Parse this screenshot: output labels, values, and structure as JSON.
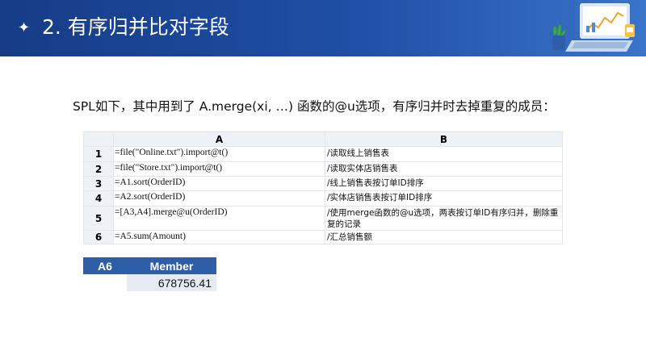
{
  "header": {
    "star": "✦",
    "title": "2. 有序归并比对字段"
  },
  "intro": "SPL如下，其中用到了 A.merge(xi, …) 函数的@u选项，有序归并时去掉重复的成员：",
  "grid": {
    "columns": [
      "A",
      "B"
    ],
    "rows": [
      {
        "num": "1",
        "a": "=file(\"Online.txt\").import@t()",
        "b": "/读取线上销售表"
      },
      {
        "num": "2",
        "a": "=file(\"Store.txt\").import@t()",
        "b": "/读取实体店销售表"
      },
      {
        "num": "3",
        "a": "=A1.sort(OrderID)",
        "b": "/线上销售表按订单ID排序"
      },
      {
        "num": "4",
        "a": "=A2.sort(OrderID)",
        "b": "/实体店销售表按订单ID排序"
      },
      {
        "num": "5",
        "a": "=[A3,A4].merge@u(OrderID)",
        "b": "/使用merge函数的@u选项，两表按订单ID有序归并，删除重复的记录"
      },
      {
        "num": "6",
        "a": "=A5.sum(Amount)",
        "b": "/汇总销售额"
      }
    ]
  },
  "result": {
    "cell": "A6",
    "column": "Member",
    "value": "678756.41"
  },
  "colors": {
    "header_dark": "#163c86",
    "header_light": "#3a74c8",
    "result_header": "#2f5ea8",
    "result_value_bg": "#e6ebf3"
  }
}
